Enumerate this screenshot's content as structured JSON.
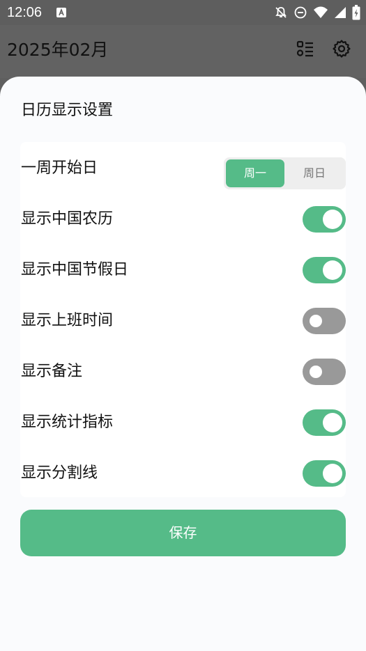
{
  "status_bar": {
    "time": "12:06",
    "left_icon": "font-a-icon",
    "right_icons": [
      "notifications-off-icon",
      "do-not-disturb-icon",
      "wifi-icon",
      "cellular-signal-icon",
      "battery-charging-icon"
    ]
  },
  "app_bar": {
    "title": "2025年02月",
    "actions": [
      "list-view-icon",
      "gear-icon"
    ]
  },
  "sheet": {
    "title": "日历显示设置",
    "week_start": {
      "label": "一周开始日",
      "options": [
        "周一",
        "周日"
      ],
      "selected": "周一"
    },
    "toggles": [
      {
        "label": "显示中国农历",
        "on": true
      },
      {
        "label": "显示中国节假日",
        "on": true
      },
      {
        "label": "显示上班时间",
        "on": false
      },
      {
        "label": "显示备注",
        "on": false
      },
      {
        "label": "显示统计指标",
        "on": true
      },
      {
        "label": "显示分割线",
        "on": true
      }
    ],
    "save_label": "保存"
  },
  "colors": {
    "accent": "#55bb88",
    "toggle_off": "#999999",
    "scrim": "#5f5f5f"
  }
}
